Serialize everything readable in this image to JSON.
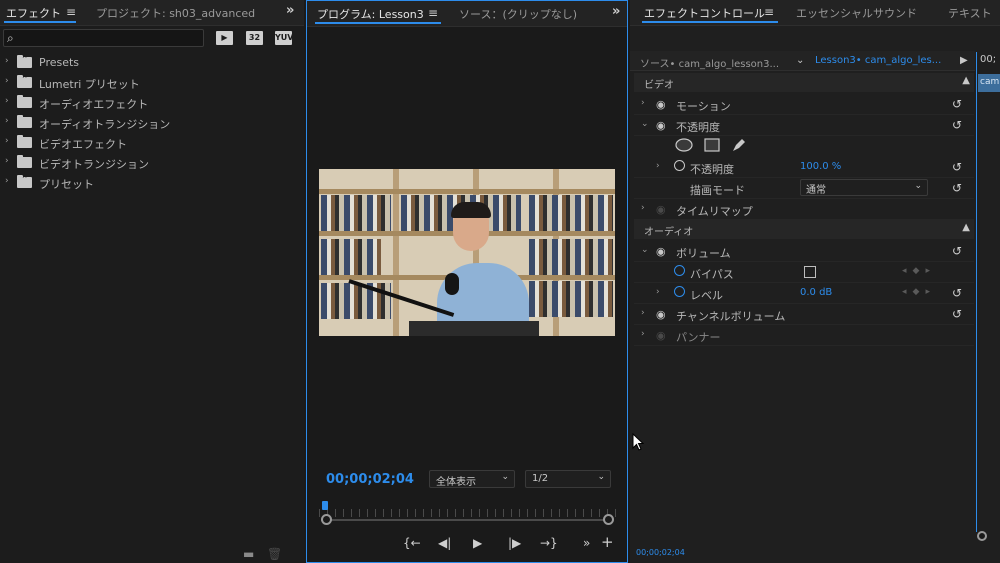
{
  "left_panel": {
    "tabs": [
      {
        "label": "エフェクト",
        "active": true
      },
      {
        "label": "プロジェクト: sh03_advanced",
        "active": false
      }
    ],
    "filter_buttons": [
      "32",
      "YUV"
    ],
    "tree": [
      {
        "label": "Presets",
        "star": true
      },
      {
        "label": "Lumetri プリセット",
        "star": true
      },
      {
        "label": "オーディオエフェクト",
        "star": false
      },
      {
        "label": "オーディオトランジション",
        "star": false
      },
      {
        "label": "ビデオエフェクト",
        "star": false
      },
      {
        "label": "ビデオトランジション",
        "star": false
      },
      {
        "label": "プリセット",
        "star": true
      }
    ]
  },
  "program_monitor": {
    "tabs": [
      {
        "label": "プログラム: Lesson3",
        "active": true
      },
      {
        "label": "ソース：(クリップなし)",
        "active": false
      }
    ],
    "timecode": "00;00;02;04",
    "zoom_select": "全体表示",
    "resolution_select": "1/2",
    "playhead_fraction": 0.01
  },
  "effect_controls": {
    "tabs": [
      {
        "label": "エフェクトコントロール",
        "active": true
      },
      {
        "label": "エッセンシャルサウンド",
        "active": false
      },
      {
        "label": "テキスト",
        "active": false
      }
    ],
    "source_label": "ソース• cam_algo_lesson3...",
    "sequence_label": "Lesson3• cam_algo_les...",
    "timeline_time": "00;",
    "timeline_clip": "cam",
    "video_section": "ビデオ",
    "audio_section": "オーディオ",
    "rows": {
      "motion": "モーション",
      "opacity": "不透明度",
      "opacity_param": "不透明度",
      "opacity_value": "100.0 %",
      "blend_mode_label": "描画モード",
      "blend_mode_value": "通常",
      "time_remap": "タイムリマップ",
      "volume": "ボリューム",
      "bypass": "バイパス",
      "level": "レベル",
      "level_value": "0.0 dB",
      "channel_volume": "チャンネルボリューム",
      "panner": "パンナー"
    },
    "bottom_time": "00;00;02;04"
  },
  "colors": {
    "accent": "#2d8ceb",
    "panel_bg": "#1e1e1e"
  }
}
